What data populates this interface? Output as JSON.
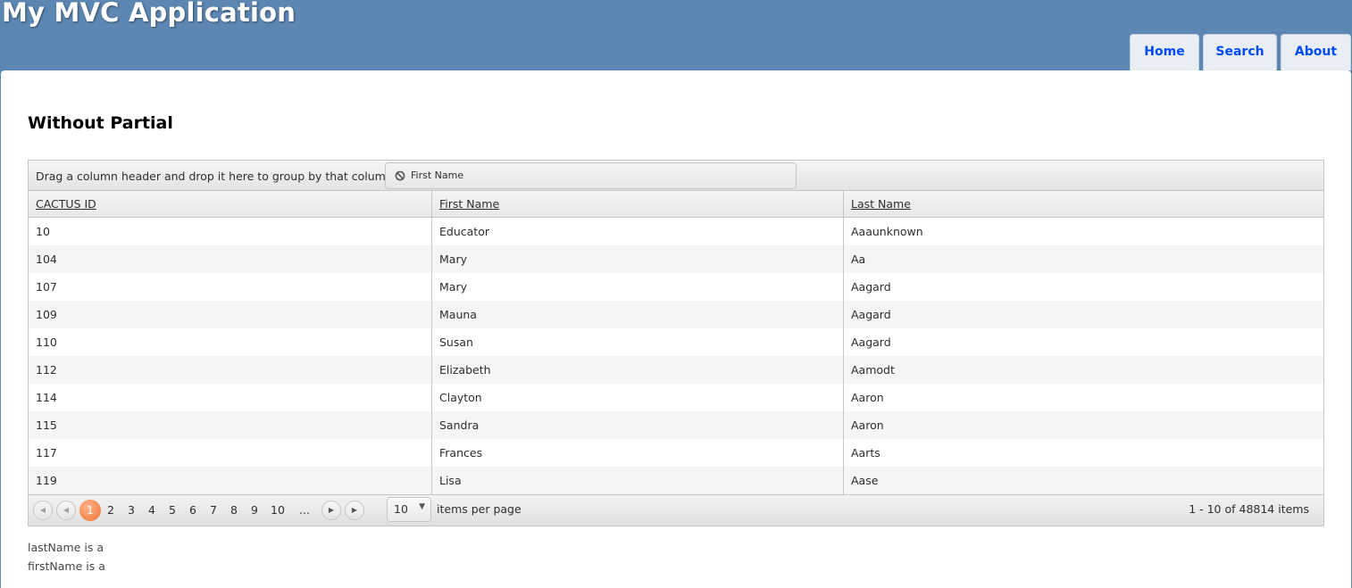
{
  "header": {
    "site_title": "My MVC Application"
  },
  "menu": {
    "items": [
      {
        "label": "Home"
      },
      {
        "label": "Search"
      },
      {
        "label": "About"
      }
    ]
  },
  "page": {
    "heading": "Without Partial"
  },
  "grid": {
    "group_hint": "Drag a column header and drop it here to group by that column",
    "drag_hint_label": "First Name",
    "columns": [
      "CACTUS ID",
      "First Name",
      "Last Name"
    ],
    "rows": [
      [
        "10",
        "Educator",
        "Aaaunknown"
      ],
      [
        "104",
        "Mary",
        "Aa"
      ],
      [
        "107",
        "Mary",
        "Aagard"
      ],
      [
        "109",
        "Mauna",
        "Aagard"
      ],
      [
        "110",
        "Susan",
        "Aagard"
      ],
      [
        "112",
        "Elizabeth",
        "Aamodt"
      ],
      [
        "114",
        "Clayton",
        "Aaron"
      ],
      [
        "115",
        "Sandra",
        "Aaron"
      ],
      [
        "117",
        "Frances",
        "Aarts"
      ],
      [
        "119",
        "Lisa",
        "Aase"
      ]
    ]
  },
  "pager": {
    "current_page": "1",
    "pages": [
      "2",
      "3",
      "4",
      "5",
      "6",
      "7",
      "8",
      "9",
      "10",
      "..."
    ],
    "page_size": "10",
    "page_size_label": "items per page",
    "info": "1 - 10 of 48814 items"
  },
  "output": {
    "lines": [
      "lastName is a",
      "firstName is a"
    ]
  }
}
